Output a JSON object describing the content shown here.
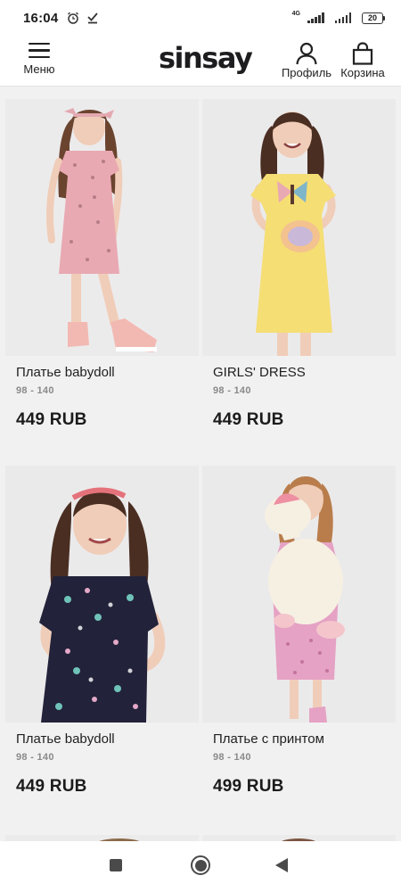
{
  "status_bar": {
    "time": "16:04",
    "network_label": "4G",
    "battery": "20",
    "icons": [
      "alarm-icon",
      "check-download-icon",
      "signal-icon",
      "signal-icon-2",
      "battery-icon"
    ]
  },
  "header": {
    "menu_label": "Меню",
    "logo_text": "sinsay",
    "profile_label": "Профиль",
    "cart_label": "Корзина"
  },
  "products": [
    {
      "name": "Платье babydoll",
      "sizes": "98 - 140",
      "price": "449 RUB",
      "image": "girl-pink-floral-dress"
    },
    {
      "name": "GIRLS' DRESS",
      "sizes": "98 - 140",
      "price": "449 RUB",
      "image": "girl-yellow-dress"
    },
    {
      "name": "Платье babydoll",
      "sizes": "98 - 140",
      "price": "449 RUB",
      "image": "girl-navy-unicorn-dress"
    },
    {
      "name": "Платье с принтом",
      "sizes": "98 - 140",
      "price": "499 RUB",
      "image": "girl-pink-print-dress-plush"
    }
  ],
  "colors": {
    "background": "#f1f1f2",
    "text": "#1b1b1b",
    "muted": "#8a8a8a",
    "photo_bg": "#ecebec"
  },
  "nav_bar": {
    "icons": [
      "square-recents-icon",
      "circle-home-icon",
      "triangle-back-icon"
    ]
  }
}
